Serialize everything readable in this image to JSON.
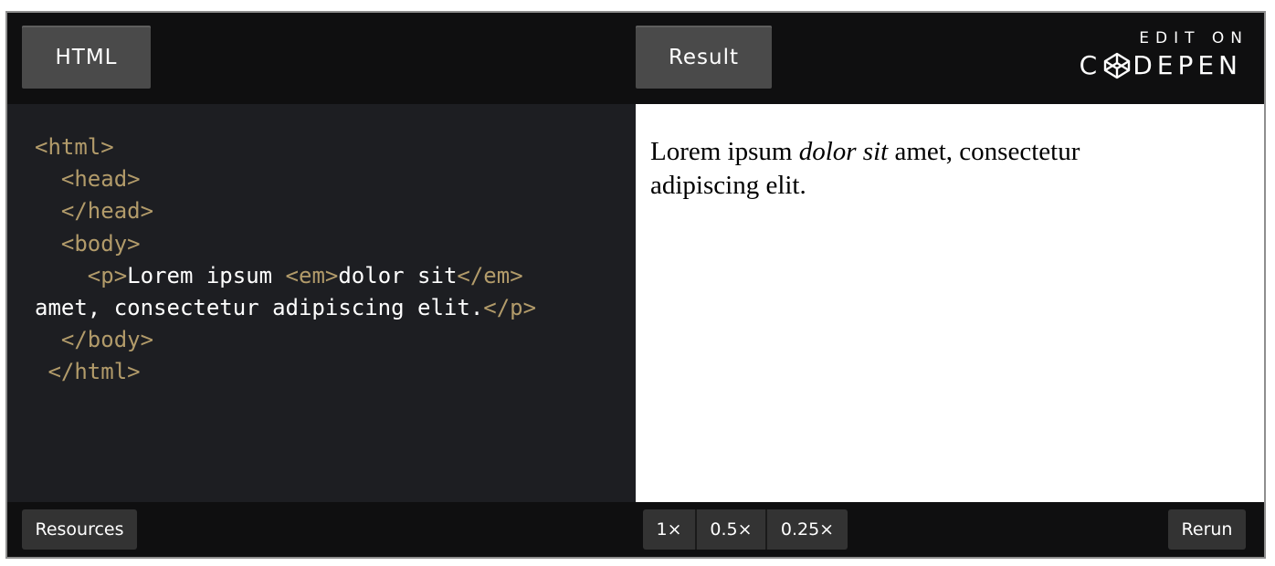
{
  "tabs": {
    "html_label": "HTML",
    "result_label": "Result"
  },
  "logo": {
    "edit_on": "EDIT ON",
    "brand_left": "C",
    "brand_right": "DEPEN"
  },
  "editor": {
    "lines": [
      [
        {
          "t": "tag",
          "v": "<html>"
        }
      ],
      [
        {
          "t": "tag",
          "v": "  <head>"
        }
      ],
      [
        {
          "t": "tag",
          "v": "  </head>"
        }
      ],
      [
        {
          "t": "tag",
          "v": "  <body>"
        }
      ],
      [
        {
          "t": "tag",
          "v": "    <p>"
        },
        {
          "t": "txt",
          "v": "Lorem ipsum "
        },
        {
          "t": "tag",
          "v": "<em>"
        },
        {
          "t": "txt",
          "v": "dolor sit"
        },
        {
          "t": "tag",
          "v": "</em>"
        }
      ],
      [
        {
          "t": "txt",
          "v": "amet, consectetur adipiscing elit."
        },
        {
          "t": "tag",
          "v": "</p>"
        }
      ],
      [
        {
          "t": "tag",
          "v": "  </body>"
        }
      ],
      [
        {
          "t": "tag",
          "v": " </html>"
        }
      ]
    ]
  },
  "result": {
    "before": "Lorem ipsum ",
    "emphasis": "dolor sit",
    "after": " amet, consectetur adipiscing elit."
  },
  "footer": {
    "resources_label": "Resources",
    "zoom_options": [
      "1×",
      "0.5×",
      "0.25×"
    ],
    "rerun_label": "Rerun"
  },
  "colors": {
    "tag": "#b29b6a",
    "editor_bg": "#1d1e22",
    "bar_bg": "#0f0f10",
    "button_bg": "#4a4a4a"
  }
}
